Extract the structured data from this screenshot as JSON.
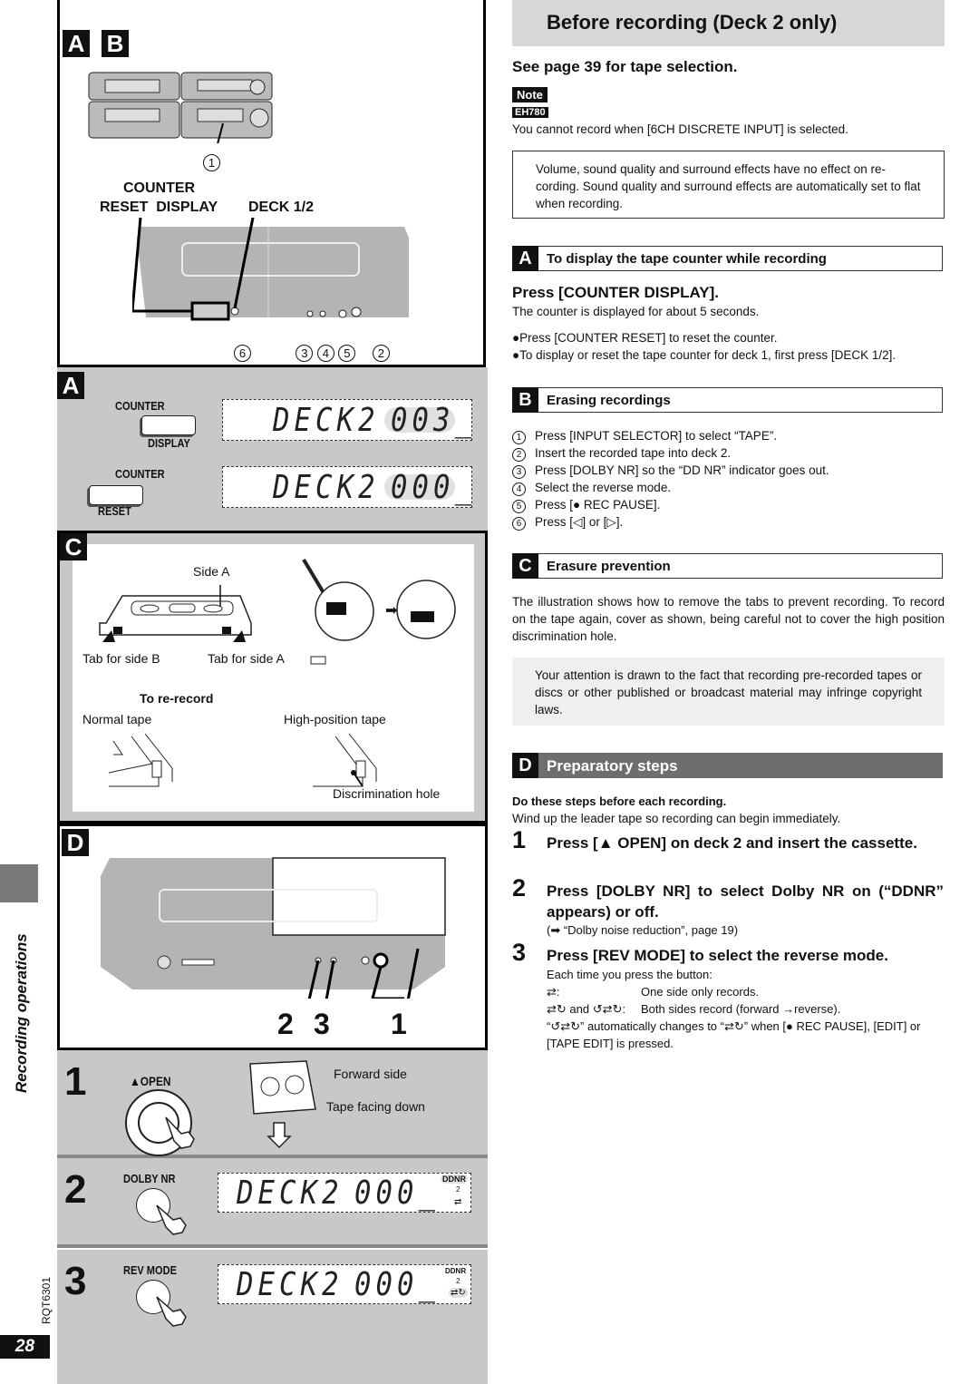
{
  "page": {
    "side_label": "Recording operations",
    "doc_code": "RQT6301",
    "page_number": "28"
  },
  "left": {
    "ab": {
      "badges": [
        "A",
        "B"
      ],
      "callout_1": "1",
      "label_counter": "COUNTER",
      "label_reset_display": "RESET  DISPLAY",
      "label_deck": "DECK 1/2",
      "callouts": [
        "6",
        "3",
        "4",
        "5",
        "2"
      ]
    },
    "a": {
      "badge": "A",
      "counter_display": {
        "top": "COUNTER",
        "bottom": "DISPLAY"
      },
      "counter_reset": {
        "top": "COUNTER",
        "bottom": "RESET"
      },
      "lcd1": {
        "deck": "DECK2",
        "count": "003_"
      },
      "lcd2": {
        "deck": "DECK2",
        "count": "000_"
      }
    },
    "c": {
      "badge": "C",
      "side_a": "Side A",
      "tab_b": "Tab for side B",
      "tab_a": "Tab for side A",
      "re_record": "To re-record",
      "normal_tape": "Normal tape",
      "high_tape": "High-position tape",
      "disc_hole": "Discrimination hole"
    },
    "d": {
      "badge": "D",
      "callouts": [
        "2",
        "3",
        "1"
      ]
    },
    "steps": [
      {
        "num": "1",
        "button": "▲OPEN",
        "forward_side": "Forward side",
        "tape_down": "Tape facing down"
      },
      {
        "num": "2",
        "button": "DOLBY NR",
        "lcd": {
          "deck": "DECK2",
          "count": "000_",
          "nr": "DDNR",
          "deck_ind": "2",
          "rev": "⇄"
        }
      },
      {
        "num": "3",
        "button": "REV MODE",
        "lcd": {
          "deck": "DECK2",
          "count": "000_",
          "nr": "DDNR",
          "deck_ind": "2",
          "rev": "⇄↻"
        }
      }
    ]
  },
  "right": {
    "title": "Before recording (Deck 2 only)",
    "tape_selection": "See page 39 for tape selection.",
    "note_label": "Note",
    "model_label": "EH780",
    "note_text": "You cannot record when [6CH DISCRETE INPUT] is selected.",
    "boxed_note": "Volume, sound quality and surround effects have no effect on re-cording. Sound quality and surround effects are automatically set to flat when recording.",
    "sections": {
      "a": {
        "badge": "A",
        "title": "To display the tape counter while recording",
        "instruction": "Press [COUNTER DISPLAY].",
        "desc": "The counter is displayed for about 5 seconds.",
        "bullets": [
          "●Press [COUNTER RESET] to reset the counter.",
          "●To display or reset the tape counter for deck 1, first press [DECK 1/2]."
        ]
      },
      "b": {
        "badge": "B",
        "title": "Erasing recordings",
        "steps": [
          {
            "n": "1",
            "text": "Press [INPUT SELECTOR] to select “TAPE”."
          },
          {
            "n": "2",
            "text": "Insert the recorded tape into deck 2."
          },
          {
            "n": "3",
            "text": "Press [DOLBY NR] so the “DD NR” indicator goes out."
          },
          {
            "n": "4",
            "text": "Select the reverse mode."
          },
          {
            "n": "5",
            "text": "Press [● REC PAUSE]."
          },
          {
            "n": "6",
            "text": "Press [◁] or [▷]."
          }
        ]
      },
      "c": {
        "badge": "C",
        "title": "Erasure prevention",
        "text": "The illustration shows how to remove the tabs to prevent recording. To record on the tape again, cover as shown, being careful not to cover the high position discrimination hole.",
        "copyright": "Your attention is drawn to the fact that recording pre-recorded tapes or discs or other published or broadcast material may infringe copyright laws."
      },
      "d": {
        "badge": "D",
        "title": "Preparatory steps",
        "intro_bold": "Do these steps before each recording.",
        "intro": "Wind up the leader tape so recording can begin immediately.",
        "steps": [
          {
            "n": "1",
            "text": "Press [▲ OPEN] on deck 2 and insert the cassette."
          },
          {
            "n": "2",
            "text": "Press [DOLBY NR] to select Dolby NR on (“DDNR” appears) or off.",
            "ref": "(➡ “Dolby noise reduction”, page 19)"
          },
          {
            "n": "3",
            "text": "Press [REV MODE] to select the reverse mode.",
            "sub_intro": "Each time you press the button:",
            "modes": [
              {
                "icon": "⇄:",
                "desc": "One side only records."
              },
              {
                "icon": "⇄↻ and ↺⇄↻:",
                "desc": "Both sides record (forward →reverse)."
              }
            ],
            "note": "“↺⇄↻” automatically changes to “⇄↻” when [● REC PAUSE], [EDIT] or [TAPE EDIT] is pressed."
          }
        ]
      }
    }
  }
}
